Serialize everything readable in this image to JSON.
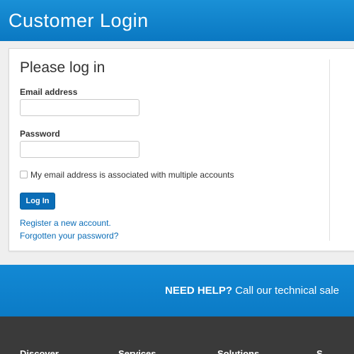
{
  "header": {
    "title": "Customer Login"
  },
  "login": {
    "heading": "Please log in",
    "email_label": "Email address",
    "email_value": "",
    "password_label": "Password",
    "password_value": "",
    "multi_account_label": "My email address is associated with multiple accounts",
    "multi_account_checked": false,
    "submit_label": "Log In",
    "register_link": "Register a new account.",
    "forgot_link": "Forgotten your password?"
  },
  "help": {
    "lead": "NEED HELP?",
    "text": " Call our technical sale"
  },
  "footer": {
    "columns": [
      "Discover",
      "Services",
      "Solutions",
      "S"
    ]
  },
  "colors": {
    "brand_blue": "#0a78c2",
    "button_blue": "#0a6db7",
    "footer_dark": "#3a3a3a"
  }
}
